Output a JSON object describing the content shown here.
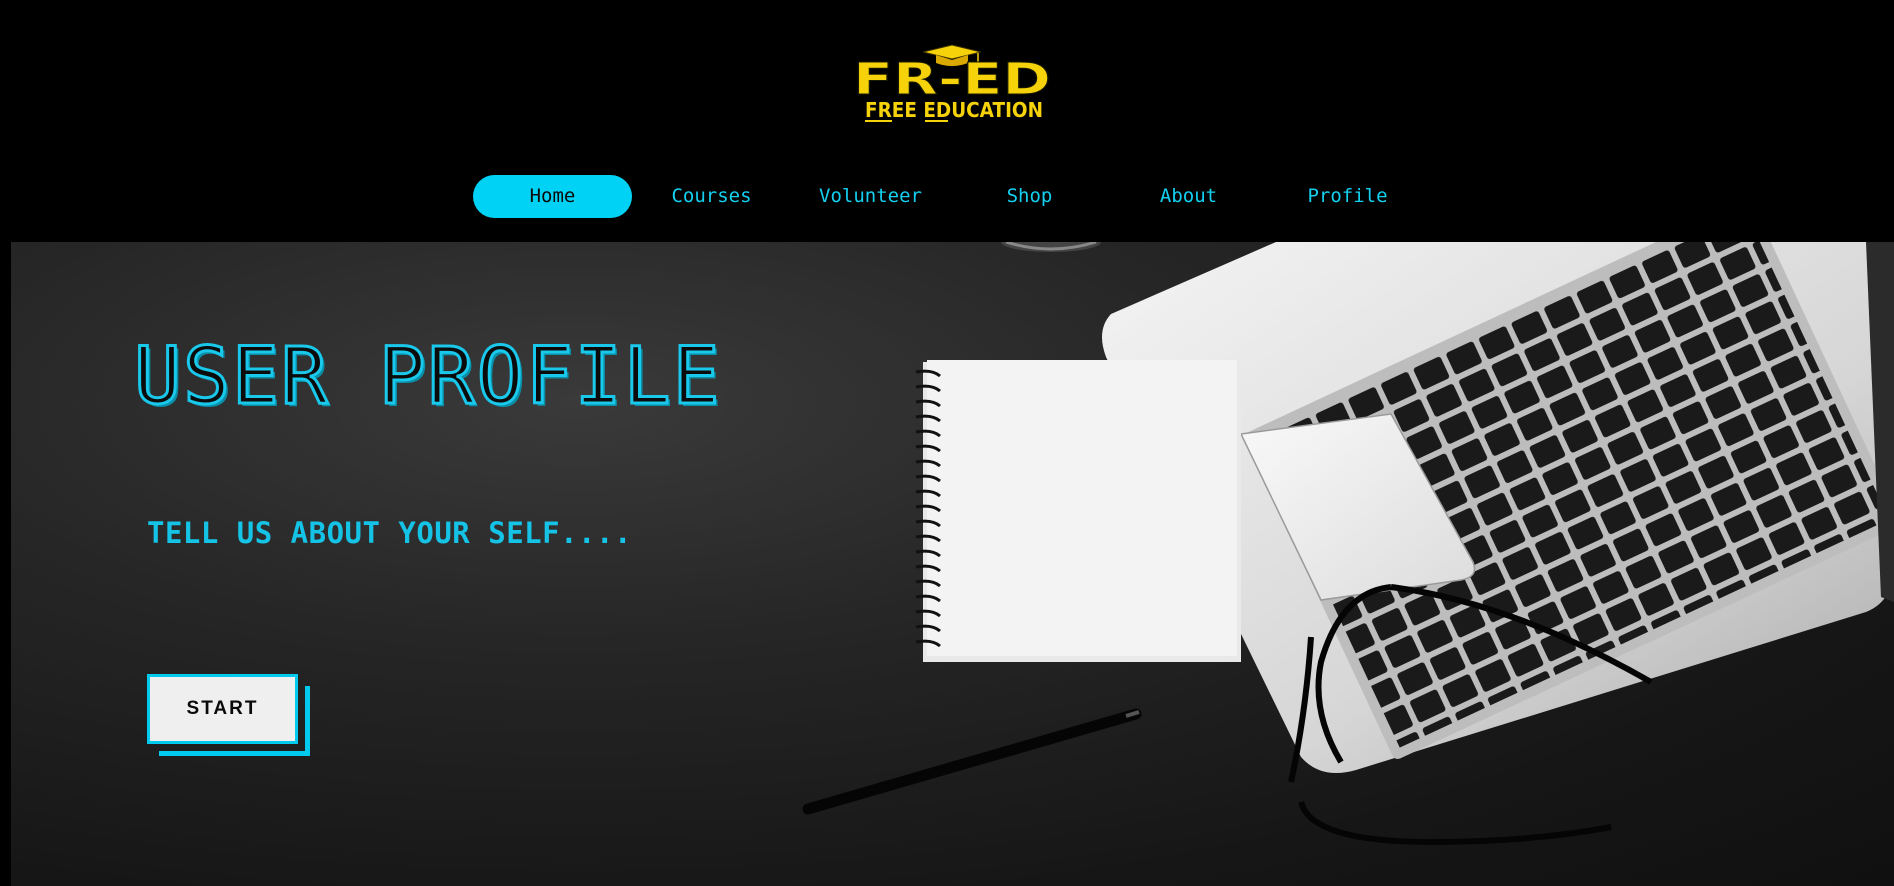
{
  "logo": {
    "title": "FR-ED",
    "subtitle": "FREE EDUCATION"
  },
  "nav": {
    "items": [
      {
        "label": "Home",
        "active": true
      },
      {
        "label": "Courses",
        "active": false
      },
      {
        "label": "Volunteer",
        "active": false
      },
      {
        "label": "Shop",
        "active": false
      },
      {
        "label": "About",
        "active": false
      },
      {
        "label": "Profile",
        "active": false
      }
    ]
  },
  "hero": {
    "title": "USER PROFILE",
    "subtitle": "TELL US ABOUT YOUR SELF....",
    "start_label": "START"
  },
  "colors": {
    "accent": "#00d2f5",
    "logo_yellow": "#f5d20a",
    "background": "#000000"
  }
}
